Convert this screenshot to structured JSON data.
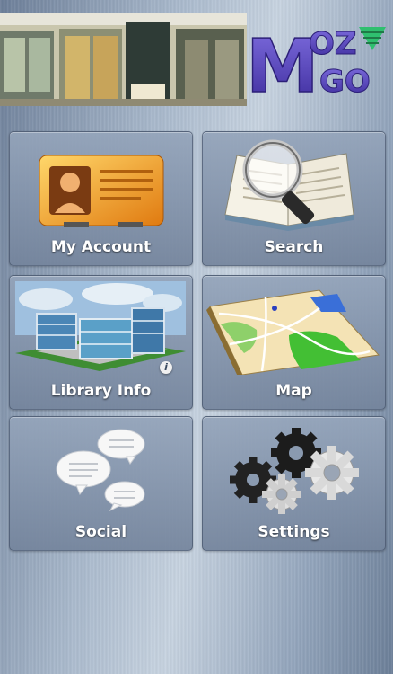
{
  "header": {
    "banner_alt": "library building entrance photo",
    "logo": {
      "letters": [
        "M",
        "OZ",
        "GO"
      ]
    }
  },
  "menu": {
    "tiles": [
      {
        "label": "My Account",
        "icon": "id-card-icon"
      },
      {
        "label": "Search",
        "icon": "magnifier-book-icon"
      },
      {
        "label": "Library Info",
        "icon": "building-icon",
        "info_badge": "i"
      },
      {
        "label": "Map",
        "icon": "map-icon"
      },
      {
        "label": "Social",
        "icon": "chat-bubbles-icon"
      },
      {
        "label": "Settings",
        "icon": "gears-icon"
      }
    ]
  },
  "colors": {
    "label_text": "#ffffff",
    "logo_purple": "#5a46b8",
    "logo_green": "#2fbf6f"
  }
}
